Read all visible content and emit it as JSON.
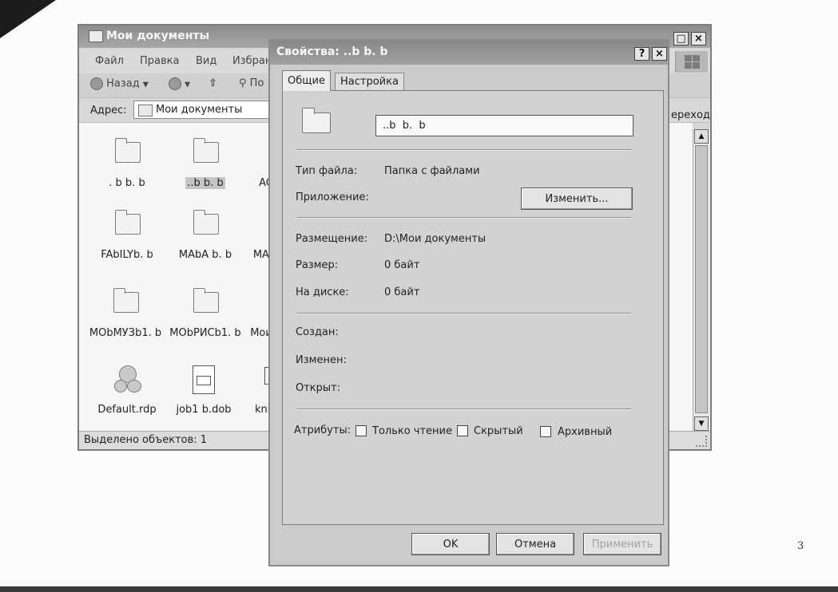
{
  "explorer": {
    "title": "Мои документы",
    "menu": [
      "Файл",
      "Правка",
      "Вид",
      "Избран"
    ],
    "toolbar": {
      "back": "Назад",
      "search": "По"
    },
    "address": {
      "label": "Адрес:",
      "value": "Мои документы",
      "go": "ереход"
    },
    "items": [
      {
        "label": ". b  b.  b",
        "type": "folder"
      },
      {
        "label": "..b  b.  b",
        "type": "folder",
        "selected": true
      },
      {
        "label": "AC",
        "type": "folder-hidden"
      },
      {
        "label": "FAbILYb.  b",
        "type": "folder"
      },
      {
        "label": "MAbA  b.  b",
        "type": "folder"
      },
      {
        "label": "MAb",
        "type": "folder-hidden"
      },
      {
        "label": "MObMУЗb1.  b",
        "type": "folder"
      },
      {
        "label": "MObРИСb1.  b",
        "type": "folder"
      },
      {
        "label": "Мои",
        "type": "folder-hidden"
      },
      {
        "label": "Default.rdp",
        "type": "rdp"
      },
      {
        "label": "job1  b.dob",
        "type": "document"
      },
      {
        "label": "knb",
        "type": "document-partial"
      }
    ],
    "status": "Выделено объектов: 1"
  },
  "dialog": {
    "title": "Свойства: ..b   b.  b",
    "help_btn": "?",
    "close_btn": "×",
    "tabs": [
      "Общие",
      "Настройка"
    ],
    "name": "..b  b.  b",
    "type_label": "Тип файла:",
    "type_value": "Папка с файлами",
    "app_label": "Приложение:",
    "change_button": "Изменить...",
    "location_label": "Размещение:",
    "location_value": "D:\\Мои документы",
    "size_label": "Размер:",
    "size_value": "0 байт",
    "disk_label": "На диске:",
    "disk_value": "0 байт",
    "created_label": "Создан:",
    "modified_label": "Изменен:",
    "opened_label": "Открыт:",
    "attributes_label": "Атрибуты:",
    "readonly_label": "Только чтение",
    "hidden_label": "Скрытый",
    "archive_label": "Архивный",
    "ok_button": "OK",
    "cancel_button": "Отмена",
    "apply_button": "Применить"
  },
  "page_number": "3"
}
